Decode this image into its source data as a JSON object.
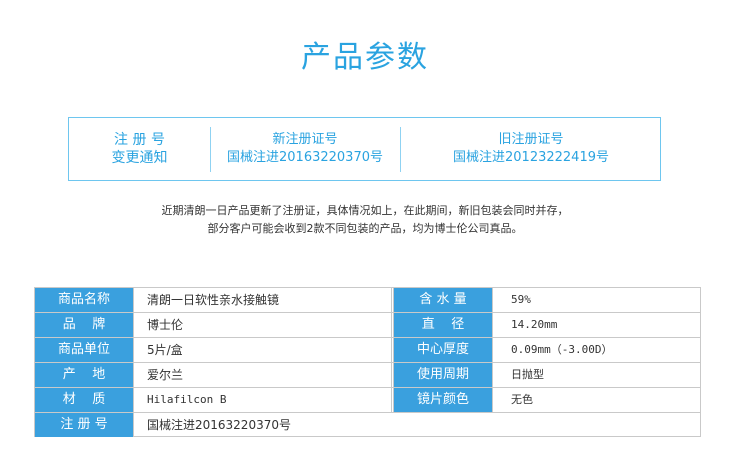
{
  "title": "产品参数",
  "notice": {
    "col1": [
      "注 册 号",
      "变更通知"
    ],
    "col2": [
      "新注册证号",
      "国械注进20163220370号"
    ],
    "col3": [
      "旧注册证号",
      "国械注进20123222419号"
    ]
  },
  "note": {
    "line1": "近期清朗一日产品更新了注册证，具体情况如上，在此期间，新旧包装会同时并存，",
    "line2": "部分客户可能会收到2款不同包装的产品，均为博士伦公司真品。"
  },
  "params": [
    {
      "label1": "商品名称",
      "value1": "清朗一日软性亲水接触镜",
      "label2": "含 水 量",
      "value2": "59%"
    },
    {
      "label1": "品    牌",
      "value1": "博士伦",
      "label2": "直    径",
      "value2": "14.20mm"
    },
    {
      "label1": "商品单位",
      "value1": "5片/盒",
      "label2": "中心厚度",
      "value2": "0.09mm（-3.00D）"
    },
    {
      "label1": "产    地",
      "value1": "爱尔兰",
      "label2": "使用周期",
      "value2": "日抛型"
    },
    {
      "label1": "材    质",
      "value1": "Hilafilcon B",
      "label2": "镜片颜色",
      "value2": "无色"
    },
    {
      "label1": "注 册 号",
      "value1": "国械注进20163220370号"
    }
  ]
}
